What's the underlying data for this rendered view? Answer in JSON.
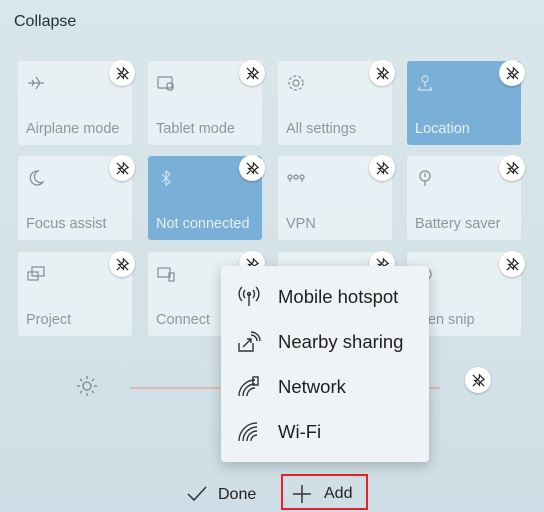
{
  "header": {
    "collapse_label": "Collapse"
  },
  "tiles": [
    {
      "label": "Airplane mode",
      "icon": "airplane-icon",
      "on": false
    },
    {
      "label": "Tablet mode",
      "icon": "tablet-icon",
      "on": false
    },
    {
      "label": "All settings",
      "icon": "gear-icon",
      "on": false
    },
    {
      "label": "Location",
      "icon": "location-icon",
      "on": true
    },
    {
      "label": "Focus assist",
      "icon": "moon-icon",
      "on": false
    },
    {
      "label": "Not connected",
      "icon": "bluetooth-icon",
      "on": true
    },
    {
      "label": "VPN",
      "icon": "vpn-icon",
      "on": false
    },
    {
      "label": "Battery saver",
      "icon": "battery-saver-icon",
      "on": false
    },
    {
      "label": "Project",
      "icon": "project-icon",
      "on": false
    },
    {
      "label": "Connect",
      "icon": "connect-icon",
      "on": false
    },
    {
      "label": "",
      "icon": "blank-icon",
      "on": false
    },
    {
      "label": "reen snip",
      "icon": "screen-snip-icon",
      "on": false
    }
  ],
  "brightness": {
    "icon": "brightness-icon"
  },
  "add_menu": {
    "items": [
      {
        "label": "Mobile hotspot",
        "icon": "mobile-hotspot-icon"
      },
      {
        "label": "Nearby sharing",
        "icon": "nearby-sharing-icon"
      },
      {
        "label": "Network",
        "icon": "network-icon"
      },
      {
        "label": "Wi-Fi",
        "icon": "wifi-icon"
      }
    ]
  },
  "footer": {
    "done_label": "Done",
    "add_label": "Add"
  },
  "colors": {
    "accent": "#7aafd8",
    "highlight_border": "#e0222a"
  }
}
